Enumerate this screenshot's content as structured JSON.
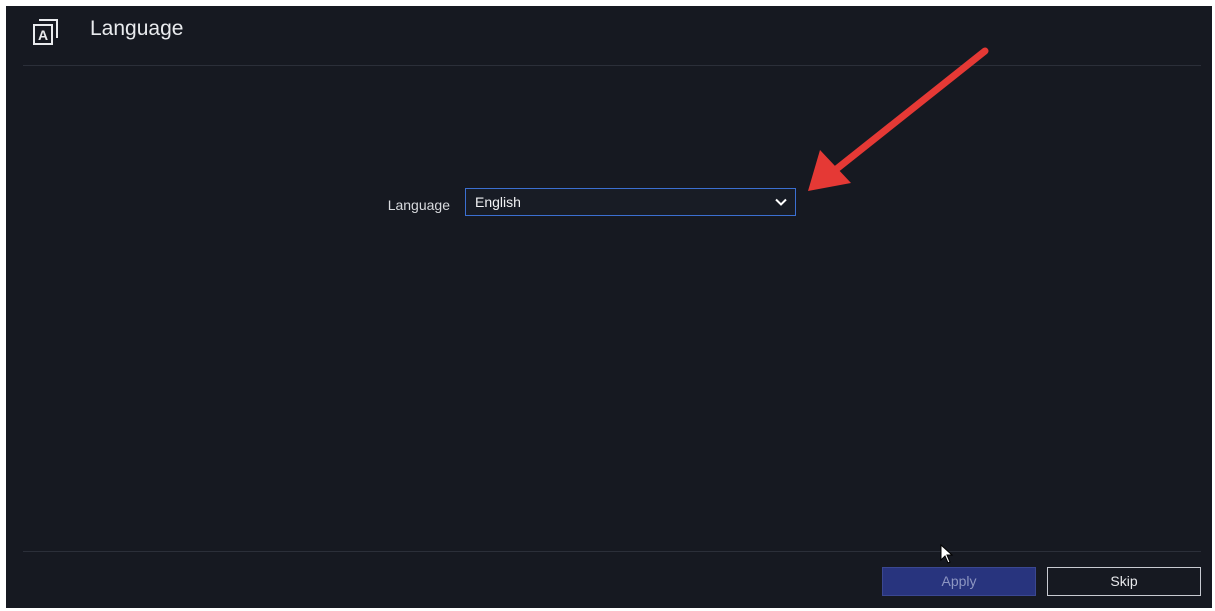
{
  "header": {
    "title": "Language",
    "icon": "language-icon",
    "icon_letter": "A"
  },
  "form": {
    "language_label": "Language",
    "language_value": "English"
  },
  "footer": {
    "apply_label": "Apply",
    "skip_label": "Skip"
  },
  "colors": {
    "background": "#161921",
    "select_border": "#3b6fd1",
    "apply_bg": "#28347e",
    "annotation_arrow": "#e53935"
  }
}
